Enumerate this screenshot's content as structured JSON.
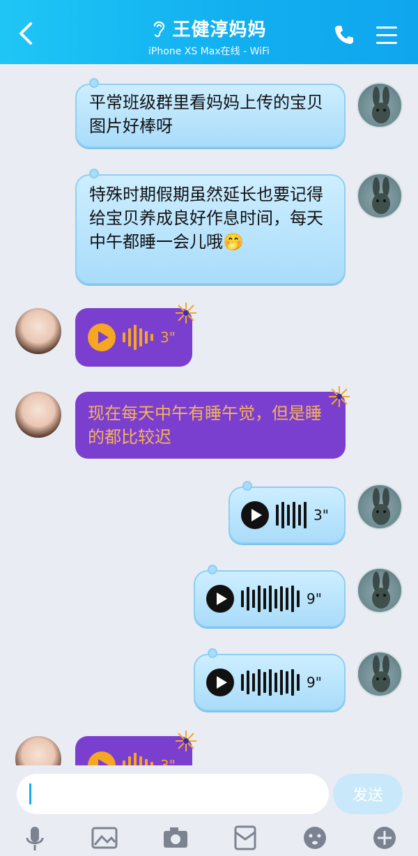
{
  "header": {
    "title": "王健淳妈妈",
    "subtitle": "iPhone XS Max在线 - WiFi",
    "icons": [
      "back-arrow-icon",
      "ear-icon",
      "phone-icon",
      "menu-icon"
    ]
  },
  "messages": [
    {
      "side": "right",
      "type": "text",
      "text": "平常班级群里看妈妈上传的宝贝图片好棒呀"
    },
    {
      "side": "right",
      "type": "text",
      "text": "特殊时期假期虽然延长也要记得给宝贝养成良好作息时间，每天中午都睡一会儿哦🤭"
    },
    {
      "side": "left",
      "type": "voice",
      "duration": "3\""
    },
    {
      "side": "left",
      "type": "text",
      "text": "现在每天中午有睡午觉，但是睡的都比较迟"
    },
    {
      "side": "right",
      "type": "voice",
      "duration": "3\""
    },
    {
      "side": "right",
      "type": "voice",
      "duration": "9\""
    },
    {
      "side": "right",
      "type": "voice",
      "duration": "9\""
    },
    {
      "side": "left",
      "type": "voice",
      "duration": "3\""
    }
  ],
  "input": {
    "value": "",
    "send_label": "发送"
  },
  "toolbar": {
    "icons": [
      "microphone-icon",
      "image-icon",
      "camera-icon",
      "red-packet-icon",
      "emoji-icon",
      "plus-icon"
    ]
  },
  "colors": {
    "header": "#12aef0",
    "blue_bubble": "#a9dcfa",
    "purple_bubble": "#7b3fd0",
    "purple_text": "#f5b25b"
  }
}
